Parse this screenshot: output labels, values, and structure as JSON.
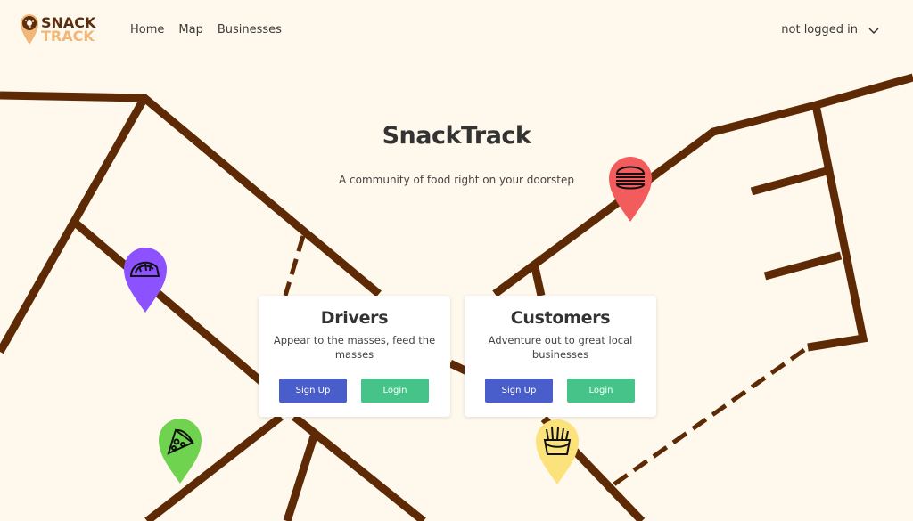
{
  "brand": {
    "line1": "SNACK",
    "line2": "TRACK"
  },
  "nav": {
    "links": [
      "Home",
      "Map",
      "Businesses"
    ]
  },
  "user": {
    "status": "not logged in"
  },
  "hero": {
    "title": "SnackTrack",
    "subtitle": "A community of food right on your doorstep"
  },
  "cards": [
    {
      "title": "Drivers",
      "description": "Appear to the masses, feed the masses",
      "signup_label": "Sign Up",
      "login_label": "Login"
    },
    {
      "title": "Customers",
      "description": "Adventure out to great local businesses",
      "signup_label": "Sign Up",
      "login_label": "Login"
    }
  ],
  "pins": [
    {
      "icon": "taco-icon",
      "color": "#8c52ff"
    },
    {
      "icon": "pizza-icon",
      "color": "#6fd34f"
    },
    {
      "icon": "burger-icon",
      "color": "#f25c5c"
    },
    {
      "icon": "fries-icon",
      "color": "#fbe27a"
    }
  ],
  "colors": {
    "background": "#fff9ed",
    "road": "#5e2a05",
    "signup_button": "#4a5ecb",
    "login_button": "#45c388",
    "brand_dark": "#5a2e0e",
    "brand_light": "#f0b779"
  }
}
